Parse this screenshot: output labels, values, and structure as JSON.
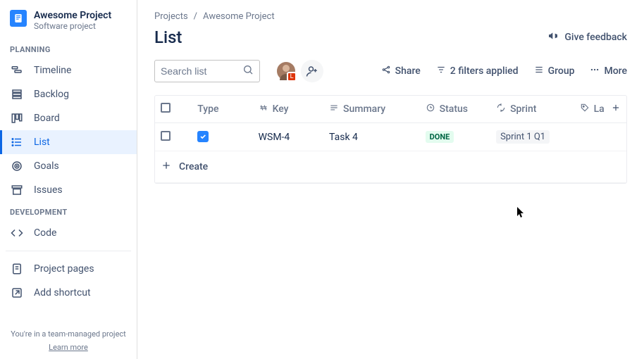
{
  "project": {
    "name": "Awesome Project",
    "subtitle": "Software project"
  },
  "sidebar": {
    "section_planning": "PLANNING",
    "section_development": "DEVELOPMENT",
    "items": {
      "timeline": "Timeline",
      "backlog": "Backlog",
      "board": "Board",
      "list": "List",
      "goals": "Goals",
      "issues": "Issues",
      "code": "Code",
      "project_pages": "Project pages",
      "add_shortcut": "Add shortcut"
    },
    "footer_text": "You're in a team-managed project",
    "footer_learn": "Learn more"
  },
  "breadcrumb": {
    "root": "Projects",
    "sep": "/",
    "current": "Awesome Project"
  },
  "page": {
    "title": "List",
    "feedback_label": "Give feedback"
  },
  "search": {
    "placeholder": "Search list"
  },
  "avatars": {
    "user1_badge": "L"
  },
  "toolbar": {
    "share": "Share",
    "filters": "2 filters applied",
    "group": "Group",
    "more": "More"
  },
  "columns": {
    "type": "Type",
    "key": "Key",
    "summary": "Summary",
    "status": "Status",
    "sprint": "Sprint",
    "labels": "La"
  },
  "rows": [
    {
      "key": "WSM-4",
      "summary": "Task 4",
      "status": "DONE",
      "sprint": "Sprint 1 Q1"
    }
  ],
  "create_label": "Create"
}
